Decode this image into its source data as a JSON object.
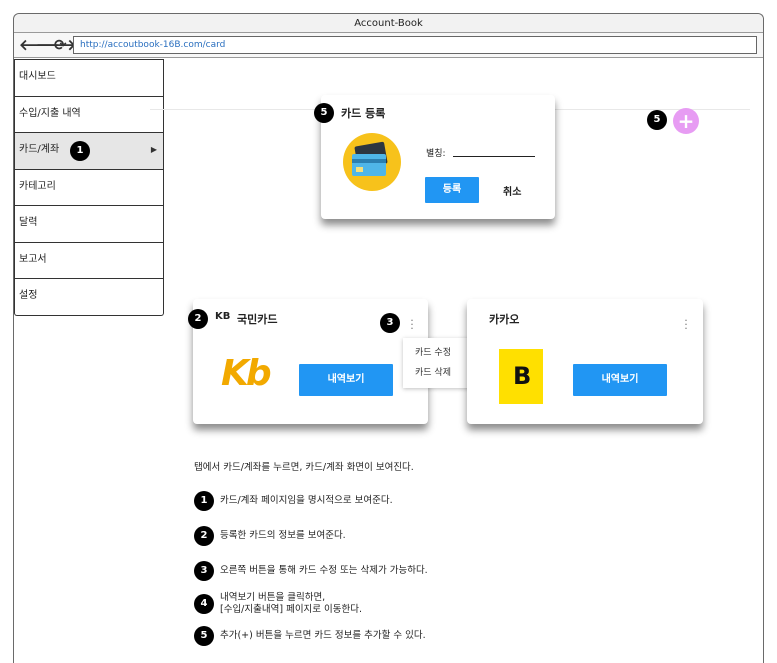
{
  "window": {
    "title": "Account-Book",
    "url": "http://accoutbook-16B.com/card",
    "nav": {
      "back": "🡐",
      "forward": "🡒",
      "reload": "⟳"
    }
  },
  "sidebar": {
    "items": [
      {
        "label": "대시보드"
      },
      {
        "label": "수입/지출 내역"
      },
      {
        "label": "카드/계좌",
        "active": true,
        "arrow": "▶"
      },
      {
        "label": "카테고리"
      },
      {
        "label": "달력"
      },
      {
        "label": "보고서"
      },
      {
        "label": "설정"
      }
    ]
  },
  "register_popup": {
    "title": "카드 등록",
    "alias_label": "별칭:",
    "submit_label": "등록",
    "cancel_label": "취소"
  },
  "add_button": {
    "label": "+",
    "color": "#e79cf3"
  },
  "cards": [
    {
      "brand": "KB",
      "name": "국민카드",
      "button": "내역보기",
      "logo": "Kb"
    },
    {
      "name": "카카오",
      "button": "내역보기",
      "logo": "B"
    }
  ],
  "card_menu": {
    "edit": "카드 수정",
    "delete": "카드 삭제"
  },
  "badges": {
    "b1": "1",
    "b2": "2",
    "b3": "3",
    "b4": "4",
    "b5": "5"
  },
  "description": {
    "intro": "탭에서 카드/계좌를 누르면, 카드/계좌 화면이 보여진다.",
    "items": [
      {
        "num": "1",
        "text": "카드/계좌 페이지임을 명시적으로 보여준다."
      },
      {
        "num": "2",
        "text": "등록한 카드의 정보를 보여준다."
      },
      {
        "num": "3",
        "text": "오른쪽 버튼을 통해 카드 수정 또는 삭제가 가능하다."
      },
      {
        "num": "4",
        "text": "내역보기 버튼을 클릭하면,",
        "text2": "[수입/지출내역] 페이지로 이동한다."
      },
      {
        "num": "5",
        "text": "추가(+) 버튼을 누르면 카드 정보를 추가할 수 있다."
      }
    ]
  },
  "colors": {
    "accent": "#2196f3",
    "kb_logo": "#f2a900",
    "kakao_logo": "#ffe000"
  }
}
